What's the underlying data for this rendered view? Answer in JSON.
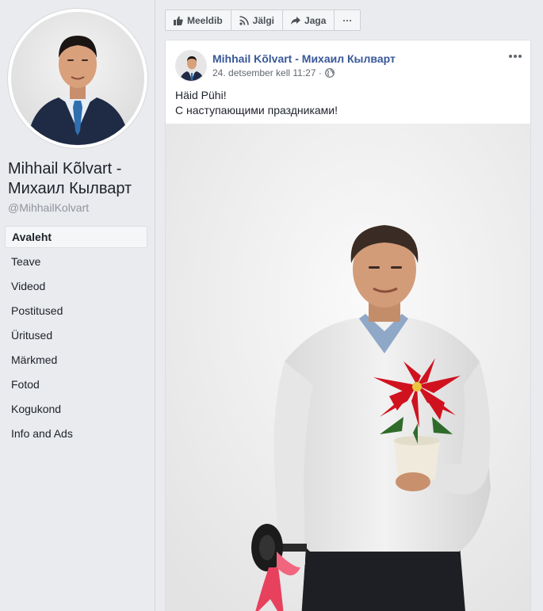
{
  "page": {
    "name": "Mihhail Kõlvart - Михаил Кылварт",
    "handle": "@MihhailKolvart"
  },
  "nav": {
    "items": [
      {
        "label": "Avaleht",
        "active": true
      },
      {
        "label": "Teave"
      },
      {
        "label": "Videod"
      },
      {
        "label": "Postitused"
      },
      {
        "label": "Üritused"
      },
      {
        "label": "Märkmed"
      },
      {
        "label": "Fotod"
      },
      {
        "label": "Kogukond"
      },
      {
        "label": "Info and Ads"
      }
    ]
  },
  "actions": {
    "like": "Meeldib",
    "follow": "Jälgi",
    "share": "Jaga",
    "more": "···"
  },
  "post": {
    "author": "Mihhail Kõlvart - Михаил Кылварт",
    "timestamp": "24. detsember kell 11:27 ·",
    "text_line1": "Häid Pühi!",
    "text_line2": "С наступающими праздниками!"
  },
  "colors": {
    "link": "#385898",
    "background": "#e9ebee",
    "poinsettia": "#d0121f"
  },
  "icons": {
    "like": "thumbs-up-icon",
    "follow": "rss-icon",
    "share": "share-arrow-icon",
    "privacy": "globe-icon",
    "menu": "ellipsis-icon"
  }
}
